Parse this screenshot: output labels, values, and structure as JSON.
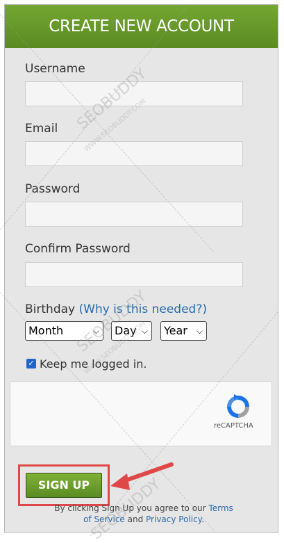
{
  "form": {
    "title": "CREATE NEW ACCOUNT",
    "username_label": "Username",
    "email_label": "Email",
    "password_label": "Password",
    "confirm_password_label": "Confirm Password",
    "birthday_label": "Birthday",
    "birthday_help_link": "(Why is this needed?)",
    "month_select": "Month",
    "day_select": "Day",
    "year_select": "Year",
    "keep_logged_in_label": "Keep me logged in.",
    "keep_logged_in_checked": true,
    "recaptcha_label": "reCAPTCHA",
    "signup_button": "SIGN UP",
    "terms_prefix": "By clicking Sign Up you agree to our",
    "terms_link": "Terms of Service",
    "terms_and": "and",
    "privacy_link": "Privacy Policy",
    "terms_suffix": "."
  },
  "watermark": {
    "brand": "SEOBUDDY",
    "url": "WWW.SEOBUDDY.COM"
  },
  "colors": {
    "header_green": "#6a9c2c",
    "button_green": "#6ea02e",
    "link_blue": "#2b6aa8",
    "highlight_red": "#e04747"
  }
}
